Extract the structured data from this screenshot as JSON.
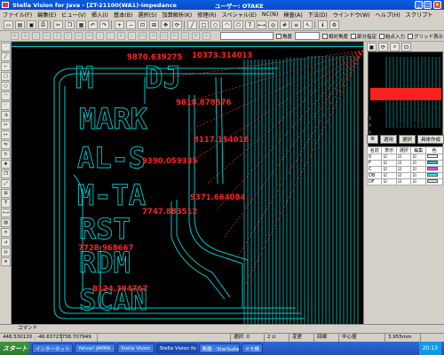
{
  "window": {
    "title": "Stella Vision for Java - [ZT-21100(WA1)-impedance",
    "user": "ユーザー: OTAKE",
    "minimize": "_",
    "maximize": "□",
    "close": "×"
  },
  "menu": [
    "ファイル(F)",
    "編集(E)",
    "ビュー(V)",
    "挿入(I)",
    "基本(B)",
    "選択(S)",
    "加算解析(K)",
    "修理(R)",
    "スペシャル(E)",
    "NC(N)",
    "検査(A)",
    "下法(D)",
    "ウインドウ(W)",
    "ヘルプ(H)",
    "スクリプト"
  ],
  "toolbar2": {
    "letters": [
      "A",
      "B",
      "C",
      "D",
      "E",
      "F",
      "G",
      "H",
      "I",
      "J",
      "K",
      "L",
      "M",
      "N",
      "O",
      "P",
      "Q",
      "R",
      "S"
    ],
    "checkboxes": [
      "角度",
      "相対角度",
      "部分指定",
      "始点入力",
      "グリッド表示"
    ]
  },
  "annotations": [
    "9870.639275",
    "10373.314013",
    "9818.878576",
    "8117.154018",
    "9390.059335",
    "9371.664084",
    "7747.883512",
    "7728.968667",
    "8124.394767"
  ],
  "canvas_text": [
    "M",
    "DJ",
    "MARK",
    "AL-S",
    "M-TA",
    "RST",
    "RDM",
    "SCAN"
  ],
  "right_panel": {
    "labels": [
      "マーク",
      "レイヤーパターン表示",
      "レイヤー"
    ],
    "tabs": [
      "適用",
      "選択",
      "具体作成"
    ],
    "layer_columns": [
      "名前",
      "表示",
      "選択",
      "編集",
      "色"
    ],
    "layers": [
      {
        "name": "0",
        "color": "#ffffff"
      },
      {
        "name": "F",
        "color": "#00c8c8"
      },
      {
        "name": "C",
        "color": "#ff40ff"
      },
      {
        "name": "DB",
        "color": "#00ffff"
      },
      {
        "name": "DF",
        "color": "#e0e0e0"
      }
    ]
  },
  "command": {
    "label": "コマンド"
  },
  "status": {
    "coords": "448.530120 , -46.637237",
    "value": "38.707949",
    "selected": "選択: 0",
    "unit": "2 U",
    "mode": "変更",
    "snap": "回線",
    "mid": "中心値",
    "zoom": "3.955mm"
  },
  "taskbar": {
    "start": "スタート",
    "items": [
      "インターネット ロケーション",
      "Yahoo! JAPAN - Mi...",
      "Stella Vision",
      "Stella Vision for...",
      "無題 - StarSuite Im...",
      "メモ帳"
    ],
    "active_index": 3,
    "clock": "20:13"
  },
  "colors": {
    "canvas_bg": "#000000",
    "geometry": "#00c8c8",
    "annotation": "#ff2020",
    "selection": "#ff2020"
  }
}
